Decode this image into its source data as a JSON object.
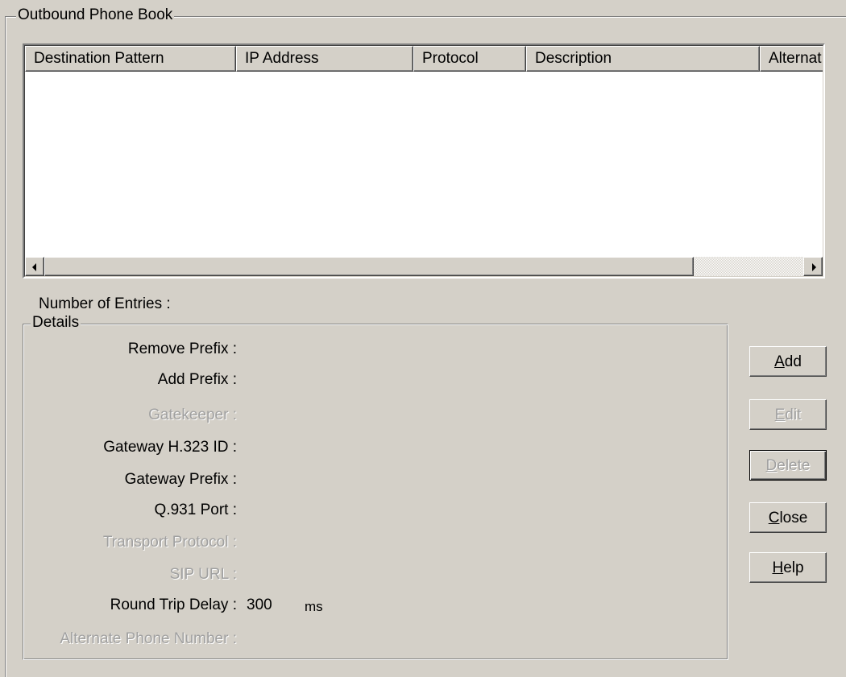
{
  "phonebook": {
    "title": "Outbound Phone Book",
    "columns": [
      "Destination Pattern",
      "IP Address",
      "Protocol",
      "Description",
      "Alternat"
    ],
    "rows": [],
    "entries_label": "Number of Entries :",
    "entries_value": ""
  },
  "details": {
    "title": "Details",
    "fields": [
      {
        "label": "Remove Prefix :",
        "value": "",
        "unit": "",
        "enabled": true
      },
      {
        "label": "Add Prefix :",
        "value": "",
        "unit": "",
        "enabled": true
      },
      {
        "label": "Gatekeeper :",
        "value": "",
        "unit": "",
        "enabled": false
      },
      {
        "label": "Gateway H.323 ID :",
        "value": "",
        "unit": "",
        "enabled": true
      },
      {
        "label": "Gateway Prefix :",
        "value": "",
        "unit": "",
        "enabled": true
      },
      {
        "label": "Q.931 Port :",
        "value": "",
        "unit": "",
        "enabled": true
      },
      {
        "label": "Transport Protocol :",
        "value": "",
        "unit": "",
        "enabled": false
      },
      {
        "label": "SIP URL :",
        "value": "",
        "unit": "",
        "enabled": false
      },
      {
        "label": "Round Trip Delay :",
        "value": "300",
        "unit": "ms",
        "enabled": true
      },
      {
        "label": "Alternate Phone Number :",
        "value": "",
        "unit": "",
        "enabled": false
      }
    ]
  },
  "buttons": {
    "add": {
      "prefix": "",
      "mnemonic": "A",
      "rest": "dd",
      "enabled": true
    },
    "edit": {
      "prefix": "",
      "mnemonic": "E",
      "rest": "dit",
      "enabled": false
    },
    "delete": {
      "prefix": "",
      "mnemonic": "D",
      "rest": "elete",
      "enabled": false
    },
    "close": {
      "prefix": "",
      "mnemonic": "C",
      "rest": "lose",
      "enabled": true
    },
    "help": {
      "prefix": "",
      "mnemonic": "H",
      "rest": "elp",
      "enabled": true
    }
  }
}
